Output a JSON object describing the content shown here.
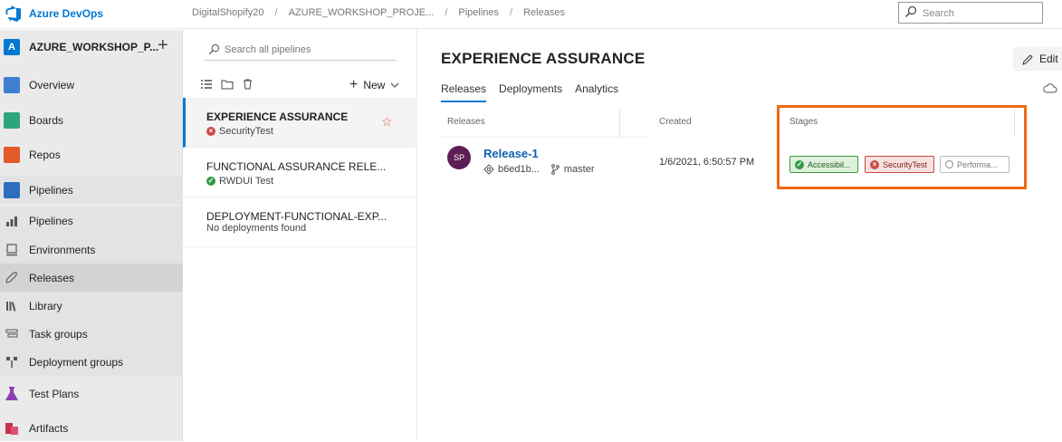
{
  "topbar": {
    "brand": "Azure DevOps",
    "breadcrumbs": [
      "DigitalShopify20",
      "AZURE_WORKSHOP_PROJE...",
      "Pipelines",
      "Releases"
    ],
    "separator": "/",
    "search_placeholder": "Search"
  },
  "sidebar": {
    "project_initial": "A",
    "project_name": "AZURE_WORKSHOP_P...",
    "add_symbol": "+",
    "items": [
      {
        "label": "Overview",
        "icon": "overview-icon",
        "color": "#3f7fcf"
      },
      {
        "label": "Boards",
        "icon": "boards-icon",
        "color": "#2da57a"
      },
      {
        "label": "Repos",
        "icon": "repos-icon",
        "color": "#e05a2b"
      },
      {
        "label": "Pipelines",
        "icon": "pipelines-icon",
        "color": "#2f6dbe"
      },
      {
        "label": "Pipelines",
        "icon": "pipelines-sub-icon",
        "color": "#555555"
      },
      {
        "label": "Environments",
        "icon": "environments-icon",
        "color": "#555555"
      },
      {
        "label": "Releases",
        "icon": "releases-icon",
        "color": "#555555"
      },
      {
        "label": "Library",
        "icon": "library-icon",
        "color": "#555555"
      },
      {
        "label": "Task groups",
        "icon": "task-groups-icon",
        "color": "#555555"
      },
      {
        "label": "Deployment groups",
        "icon": "deployment-groups-icon",
        "color": "#555555"
      },
      {
        "label": "Test Plans",
        "icon": "test-plans-icon",
        "color": "#8b3fb4"
      },
      {
        "label": "Artifacts",
        "icon": "artifacts-icon",
        "color": "#c6324e"
      }
    ]
  },
  "pipelines_list": {
    "search_placeholder": "Search all pipelines",
    "new_label": "New",
    "definitions": [
      {
        "title": "EXPERIENCE ASSURANCE",
        "status": "SecurityTest",
        "state": "failed"
      },
      {
        "title": "FUNCTIONAL ASSURANCE RELE...",
        "status": "RWDUI Test",
        "state": "succeeded"
      },
      {
        "title": "DEPLOYMENT-FUNCTIONAL-EXP...",
        "status": "No deployments found",
        "state": "none"
      }
    ]
  },
  "main": {
    "title": "EXPERIENCE ASSURANCE",
    "edit_label": "Edit",
    "tabs": [
      "Releases",
      "Deployments",
      "Analytics"
    ],
    "columns": {
      "releases": "Releases",
      "created": "Created",
      "stages": "Stages"
    },
    "release": {
      "avatar": "SP",
      "name": "Release-1",
      "commit": "b6ed1b...",
      "branch": "master",
      "created": "1/6/2021, 6:50:57 PM",
      "stages": [
        {
          "name": "Accessibil...",
          "state": "succeeded"
        },
        {
          "name": "SecurityTest",
          "state": "failed"
        },
        {
          "name": "Performa...",
          "state": "not-started"
        }
      ]
    },
    "highlight_color": "#ef6b11"
  }
}
